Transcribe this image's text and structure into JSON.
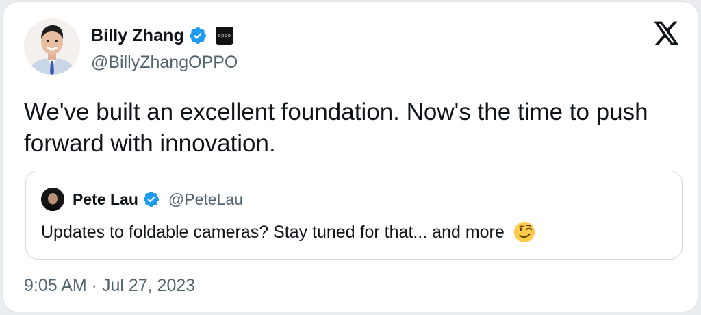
{
  "author": {
    "display_name": "Billy Zhang",
    "handle": "@BillyZhangOPPO",
    "verified_icon": "verified-badge-icon",
    "affiliate_badge_text": "oppo"
  },
  "tweet": {
    "text": "We've built an excellent foundation. Now's the time to push forward with innovation.",
    "timestamp": "9:05 AM · Jul 27, 2023"
  },
  "quoted_tweet": {
    "display_name": "Pete Lau",
    "handle": "@PeteLau",
    "text": "Updates to foldable cameras? Stay tuned for that... and more",
    "emoji": "winking-face-emoji"
  },
  "platform": {
    "logo": "x-logo-icon"
  },
  "colors": {
    "verified_blue": "#1d9bf0",
    "secondary_text": "#536471",
    "primary_text": "#0f1419",
    "border": "#cfd9de"
  }
}
